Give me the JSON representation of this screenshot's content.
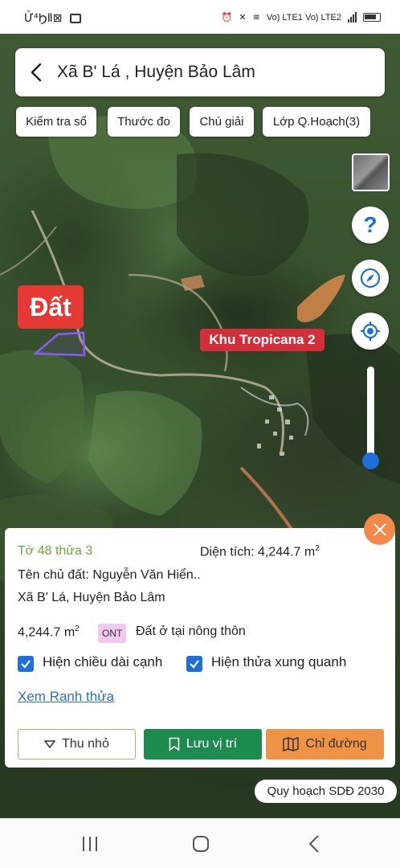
{
  "status_bar": {
    "left_text": "Ử⁴ϦⅡ⊠",
    "right_text": "Vo) LTE1 Vo) LTE2"
  },
  "header": {
    "title": "Xã B' Lá , Huyện Bảo Lâm"
  },
  "chips": [
    {
      "label": "Kiểm tra sổ"
    },
    {
      "label": "Thước đo"
    },
    {
      "label": "Chú giải"
    },
    {
      "label": "Lớp Q.Hoạch(3)"
    }
  ],
  "map": {
    "parcel_label": "Đất",
    "place_label": "Khu Tropicana 2",
    "opacity_slider_value": 0.12
  },
  "controls": {
    "layer_icon": "satellite-layer-thumbnail",
    "help_icon": "question-icon",
    "compass_icon": "compass-icon",
    "locate_icon": "locate-icon"
  },
  "panel": {
    "parcel_id": "Tờ 48 thửa 3",
    "area_label": "Diện tích: 4,244.7 m",
    "area_sup": "2",
    "owner": "Tên chủ đất: Nguyễn Văn Hiển..",
    "location": "Xã B' Lá, Huyện Bảo Lâm",
    "area_value": "4,244.7 m",
    "area_value_sup": "2",
    "land_code": "ONT",
    "land_use": "Đất ở tại nông thôn",
    "checkbox_edges": "Hiện chiều dài cạnh",
    "checkbox_neighbors": "Hiện thửa xung quanh",
    "link_boundary": "Xem Ranh thửa",
    "btn_collapse": "Thu nhỏ",
    "btn_save": "Lưu vị trí",
    "btn_directions": "Chỉ đường"
  },
  "planning_chip": "Quy hoạch SDĐ 2030",
  "colors": {
    "accent_blue": "#1e6fd9",
    "green_button": "#1d8b4e",
    "orange_button": "#ef9346",
    "label_red": "#e53935"
  }
}
